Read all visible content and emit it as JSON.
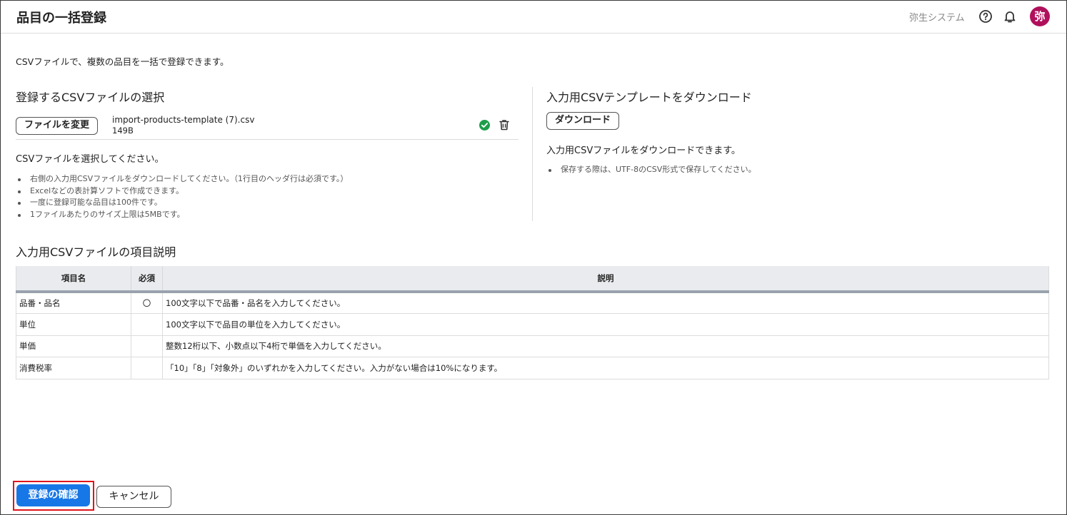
{
  "header": {
    "title": "品目の一括登録",
    "company": "弥生システム",
    "avatar_text": "弥",
    "help_icon": "help-circle-icon",
    "bell_icon": "bell-icon"
  },
  "intro": "CSVファイルで、複数の品目を一括で登録できます。",
  "upload": {
    "title": "登録するCSVファイルの選択",
    "change_button": "ファイルを変更",
    "file_name": "import-products-template (7).csv",
    "file_size": "149B",
    "message": "CSVファイルを選択してください。",
    "notes": [
      "右側の入力用CSVファイルをダウンロードしてください。（1行目のヘッダ行は必須です。）",
      "Excelなどの表計算ソフトで作成できます。",
      "一度に登録可能な品目は100件です。",
      "1ファイルあたりのサイズ上限は5MBです。"
    ]
  },
  "template": {
    "title": "入力用CSVテンプレートをダウンロード",
    "download_button": "ダウンロード",
    "message": "入力用CSVファイルをダウンロードできます。",
    "notes": [
      "保存する際は、UTF-8のCSV形式で保存してください。"
    ]
  },
  "spec": {
    "title": "入力用CSVファイルの項目説明",
    "columns": [
      "項目名",
      "必須",
      "説明"
    ],
    "rows": [
      {
        "name": "品番・品名",
        "required": "〇",
        "desc": "100文字以下で品番・品名を入力してください。"
      },
      {
        "name": "単位",
        "required": "",
        "desc": "100文字以下で品目の単位を入力してください。"
      },
      {
        "name": "単価",
        "required": "",
        "desc": "整数12桁以下、小数点以下4桁で単価を入力してください。"
      },
      {
        "name": "消費税率",
        "required": "",
        "desc": "「10」「8」「対象外」のいずれかを入力してください。入力がない場合は10%になります。"
      }
    ]
  },
  "footer": {
    "confirm_button": "登録の確認",
    "cancel_button": "キャンセル"
  },
  "colors": {
    "primary": "#1877e6",
    "avatar": "#b0105c",
    "success": "#1e9e4a",
    "highlight": "#e0141c"
  }
}
